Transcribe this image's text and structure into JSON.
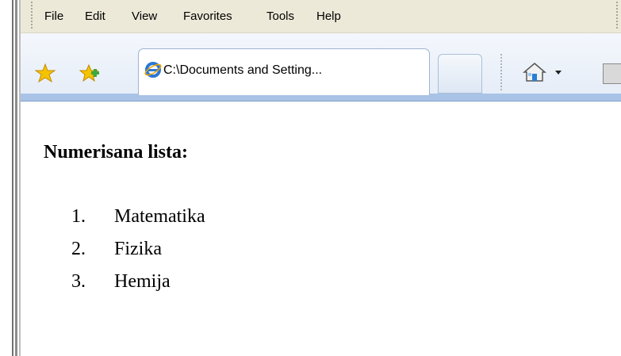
{
  "menu": [
    "File",
    "Edit",
    "View",
    "Favorites",
    "Tools",
    "Help"
  ],
  "tab": {
    "title": "C:\\Documents and Setting..."
  },
  "content": {
    "heading": "Numerisana lista:",
    "list": [
      {
        "number": "1.",
        "text": "Matematika"
      },
      {
        "number": "2.",
        "text": "Fizika"
      },
      {
        "number": "3.",
        "text": "Hemija"
      }
    ]
  },
  "colors": {
    "menubar_bg": "#ece9d8",
    "toolbar_bg": "#e4ecf7",
    "tab_border": "#9fb4d2",
    "star_yellow": "#f5c400",
    "star_green": "#3fa83a"
  }
}
